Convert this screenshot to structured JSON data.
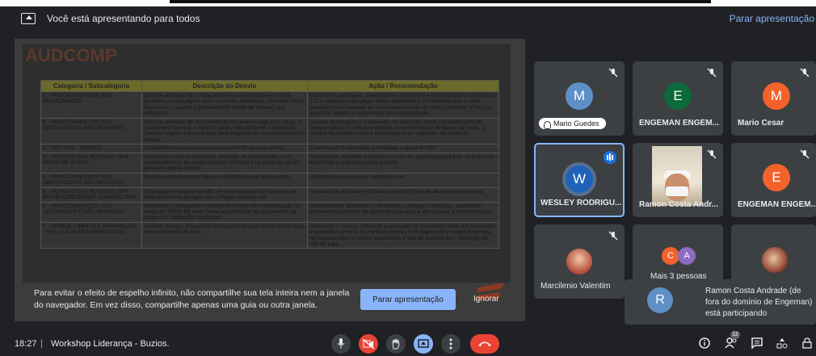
{
  "presenting_bar": {
    "message": "Você está apresentando para todos",
    "stop_link": "Parar apresentação"
  },
  "shared_doc": {
    "title": "AUDCOMP",
    "headers": [
      "Categoria / Subcategoria",
      "Descrição do Desvio",
      "Ação / Recomendação"
    ],
    "rows": [
      [
        "E - PROCEDIMENTOS / E07 - INADEQUADOS",
        "Durante processo de colocação de tesoura metálica em cesta, percebeu-se que alguns itens se seriam colocados, oferecem riscos ergonômico, usando o procedimento (modo de colocar) que utilizavam.",
        "Mandou foi paralisada, colaboradores abordados e conscientizados dos riscos. TLT e Supervisor de cargas foram abordados e foi solicitado que a cesta metálica fosse colocada em uma outra posição de modo a eliminar o risco de queda de objetos e ergonômico dos colaboradores."
      ],
      [
        "E - PROCEDIMENTOS / E03 - ADEQUADOS E NÃO SEGUIDOS",
        "Durante atividade de movimentação de redes e bags com carga, o colaborador colocou a mão na carga, não utilizando o cabo-guia. Também seguiu o guia de bola para enquanto se comunicava com o colega.",
        "Durante abordagem o colaborador foi orientado sobre o procedimento de sempre utilizar o cabo guia durante a movimentação do guia e da carga. O mesmo foi receptivo com a abordagem e às sugestões de melhoria."
      ],
      [
        "C - EPI / C06 - TRONCO",
        "Colaborador executava lava-jato usando fin-vei pela cintura.",
        "Colaborador foi abordado e solicitado o ajuste do EPI."
      ],
      [
        "B - POSIÇÃO DAS PESSOAS / B03 - RISCO DE QUEDA",
        "Colaborador estava realizando atividade de manutenção e em posição de risco de queda (apoiado o tronco e na ponta de pé em pequeno guarda corpo).",
        "Colaborador orientado a utilizar um cinto de segurança para ficar se a ter mais ergonomia e segurança para a tarefa."
      ],
      [
        "E - PROCEDIMENTOS / E03 - ADEQUADOS E NÃO SEGUIDOS",
        "Equipamento (paleteira) não tem identificação do mês correto.",
        "Orientado a equipe a cor correta do mês."
      ],
      [
        "B - POSIÇÃO DAS PESSOAS / B07 - BATER CONTRA/SER ATINGIDO POR",
        "Empregado realizava trabalho de movimentação de flanges e se colocou na linha de fogo caso o flange viesse a cair.",
        "Paralisado a atividade e definido a melhor forma de atuar nesse manobra."
      ],
      [
        "E - PROCEDIMENTOS / E03 - ADEQUADOS E NÃO SEGUIDOS",
        "Observado colaboradores realizando serviço de movimentação de carga em PROA BE onde havia possibilidade de afastamento da carga com tubulações existentes.",
        "Colaboradores abordados e sinalizado a proteger tubulações, realizando fechamento com tubo de andaime para realizar em seguida a movimentação."
      ],
      [
        "F - ORDEM, LIMPEZA E ARRUMAÇÃO / F02 - LOCAL DESORGANIZADO",
        "Durante limpeza, mangueira de lava jato lançada sobre rota de fuga sem isolamento da área.",
        "Paralisado o serviço, solicitado a execução do isolamento onde era necessário e realizada conversa na frente do serviço com supervisor e equipe envolvida na limpeza sobre os riscos associados a falta de isolamento e obstrução de rota de fuga."
      ]
    ]
  },
  "mirror_warning": {
    "text": "Para evitar o efeito de espelho infinito, não compartilhe sua tela inteira nem a janela do navegador. Em vez disso, compartilhe apenas uma guia ou outra janela.",
    "stop_button": "Parar apresentação",
    "ignore_button": "Ignorar"
  },
  "participants": [
    {
      "name": "Mario Guedes",
      "initial": "M",
      "color": "#5f8fc7",
      "style": "pill"
    },
    {
      "name": "ENGEMAN ENGEM...",
      "initial": "E",
      "color": "#0b6b3a",
      "style": "bold"
    },
    {
      "name": "Mario Cesar",
      "initial": "M",
      "color": "#f4622c",
      "style": "bold"
    },
    {
      "name": "WESLEY RODRIGU...",
      "initial": "W",
      "color": "#1e63b8",
      "style": "active"
    },
    {
      "name": "Ramon Costa Andr...",
      "initial": "",
      "color": "",
      "style": "video"
    },
    {
      "name": "ENGEMAN ENGEM...",
      "initial": "E",
      "color": "#f4622c",
      "style": "bold"
    },
    {
      "name": "Marcilenio Valentim",
      "initial": "",
      "color": "",
      "style": "photo"
    },
    {
      "name": "Mais 3 pessoas",
      "initial": "",
      "color": "",
      "style": "more"
    },
    {
      "name": "",
      "initial": "",
      "color": "",
      "style": "photo"
    }
  ],
  "more_avatars": [
    {
      "initial": "C",
      "color": "#f4622c"
    },
    {
      "initial": "A",
      "color": "#8e6bbf"
    }
  ],
  "notification": {
    "initial": "R",
    "text": "Ramon Costa Andrade (de fora do domínio de Engeman) está participando"
  },
  "bottom": {
    "time": "18:27",
    "separator": "|",
    "meeting": "Workshop Liderança - Buzios.",
    "people_count": "12"
  },
  "icons": {
    "mic": "mic-icon",
    "camera_off": "camera-off-icon",
    "hand": "raise-hand-icon",
    "present": "present-screen-icon",
    "more": "more-options-icon",
    "hangup": "hangup-icon",
    "info": "info-icon",
    "people": "people-icon",
    "chat": "chat-icon",
    "activities": "activities-icon",
    "lock": "host-controls-icon"
  }
}
